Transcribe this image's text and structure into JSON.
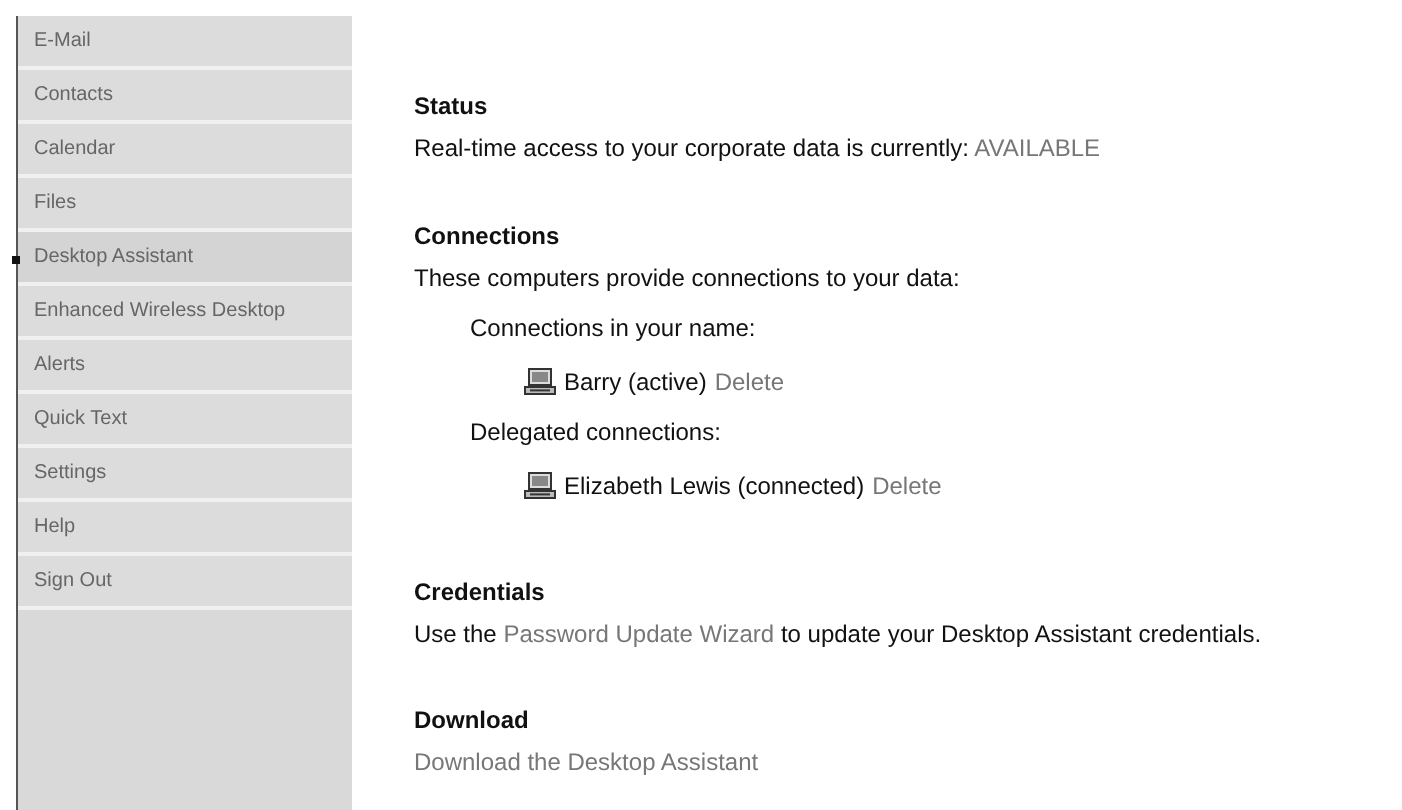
{
  "sidebar": {
    "items": [
      {
        "label": "E-Mail",
        "selected": false
      },
      {
        "label": "Contacts",
        "selected": false
      },
      {
        "label": "Calendar",
        "selected": false
      },
      {
        "label": "Files",
        "selected": false
      },
      {
        "label": "Desktop Assistant",
        "selected": true
      },
      {
        "label": "Enhanced Wireless Desktop",
        "selected": false
      },
      {
        "label": "Alerts",
        "selected": false
      },
      {
        "label": "Quick Text",
        "selected": false
      },
      {
        "label": "Settings",
        "selected": false
      },
      {
        "label": "Help",
        "selected": false
      },
      {
        "label": "Sign Out",
        "selected": false
      }
    ]
  },
  "status": {
    "heading": "Status",
    "text": "Real-time access to your corporate data is currently:",
    "value": "AVAILABLE"
  },
  "connections": {
    "heading": "Connections",
    "text": "These computers provide connections to your data:",
    "groups": [
      {
        "label": "Connections in your name:",
        "items": [
          {
            "name": "Barry (active)",
            "action": "Delete"
          }
        ]
      },
      {
        "label": "Delegated connections:",
        "items": [
          {
            "name": "Elizabeth Lewis (connected)",
            "action": "Delete"
          }
        ]
      }
    ]
  },
  "credentials": {
    "heading": "Credentials",
    "text_before": "Use the",
    "link": "Password Update Wizard",
    "text_after": "to update your Desktop Assistant credentials."
  },
  "download": {
    "heading": "Download",
    "link": "Download the Desktop Assistant"
  }
}
